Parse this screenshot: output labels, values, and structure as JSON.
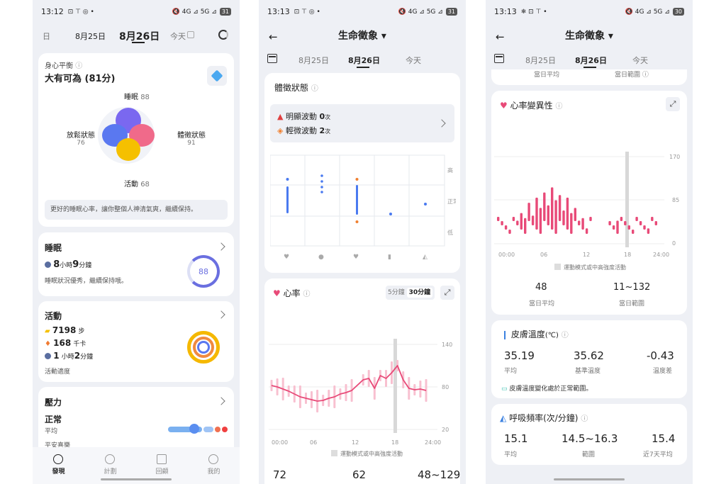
{
  "p1": {
    "status": {
      "time": "13:12",
      "icons": "⊡ ⊤ ◎ •",
      "right": "🔇 4G ⊿ 5G ⊿",
      "battery": "31"
    },
    "dates": {
      "prev_cut": "日",
      "d1": "8月25日",
      "d2": "8月26日",
      "d3": "今天"
    },
    "balance": {
      "label": "身心平衡",
      "value": "大有可為 (81分)",
      "sleep_label": "睡眠",
      "sleep_val": "88",
      "relax_label": "放鬆狀態",
      "relax_val": "76",
      "body_label": "體徵狀態",
      "body_val": "91",
      "activity_label": "活動",
      "activity_val": "68",
      "tip": "更好的睡眠心率，讓你整個人神清氣爽，繼續保持。"
    },
    "sleep": {
      "title": "睡眠",
      "h": "8",
      "h_unit": "小時",
      "m": "9",
      "m_unit": "分鐘",
      "desc": "睡眠狀況優秀，繼續保持哦。",
      "score": "88"
    },
    "activity": {
      "title": "活動",
      "steps": "7198",
      "steps_unit": "步",
      "kcal": "168",
      "kcal_unit": "千卡",
      "h": "1",
      "h_unit": "小時",
      "m": "2",
      "m_unit": "分鐘",
      "desc": "活動適度"
    },
    "stress": {
      "title": "壓力",
      "state": "正常",
      "sub": "平均",
      "note": "平安喜樂"
    },
    "nav": {
      "n1": "發現",
      "n2": "計劃",
      "n3": "回顧",
      "n4": "我的"
    }
  },
  "p2": {
    "status": {
      "time": "13:13",
      "icons": "⊡ ⊤ ◎ •",
      "right": "🔇 4G ⊿ 5G ⊿",
      "battery": "31"
    },
    "header": {
      "title": "生命徵象 ▾",
      "back": "←"
    },
    "dates": {
      "d1": "8月25日",
      "d2": "8月26日",
      "d3": "今天"
    },
    "body": {
      "title": "體徵狀態",
      "alert1_label": "明顯波動",
      "alert1_val": "0",
      "alert1_unit": "次",
      "alert2_label": "輕微波動",
      "alert2_val": "2",
      "alert2_unit": "次",
      "y_high": "高",
      "y_normal": "正常",
      "y_low": "低"
    },
    "hr": {
      "title": "心率",
      "opt1": "5分鐘",
      "opt2": "30分鐘",
      "y1": "140",
      "y2": "80",
      "y3": "20",
      "x1": "00:00",
      "x2": "06",
      "x3": "12",
      "x4": "18",
      "x5": "24:00",
      "legend": "運動模式或中高強度活動",
      "v1": "72",
      "v2": "62",
      "v3": "48~129"
    }
  },
  "p3": {
    "status": {
      "time": "13:13",
      "icons": "❄ ⊡ ⊤ •",
      "right": "🔇 4G ⊿ 5G ⊿",
      "battery": "30"
    },
    "header": {
      "title": "生命徵象 ▾",
      "back": "←"
    },
    "dates": {
      "d1": "8月25日",
      "d2": "8月26日",
      "d3": "今天"
    },
    "top": {
      "l1": "當日平均",
      "l2": "當日範圍 ⓘ"
    },
    "hrv": {
      "title": "心率變異性",
      "y1": "170",
      "y2": "85",
      "y3": "0",
      "x1": "00:00",
      "x2": "06",
      "x3": "12",
      "x4": "18",
      "x5": "24:00",
      "legend": "運動模式或中高強度活動",
      "v1": "48",
      "l1": "當日平均",
      "v2": "11~132",
      "l2": "當日範圍"
    },
    "skin": {
      "title": "皮膚溫度",
      "unit": "(℃)",
      "v1": "35.19",
      "l1": "平均",
      "v2": "35.62",
      "l2": "基準溫度",
      "v3": "-0.43",
      "l3": "溫度差",
      "note": "皮膚溫度變化處於正常範圍。"
    },
    "resp": {
      "title": "呼吸頻率",
      "unit": "(次/分鐘)",
      "v1": "15.1",
      "l1": "平均",
      "v2": "14.5~16.3",
      "l2": "範圍",
      "v3": "15.4",
      "l3": "近7天平均"
    }
  },
  "chart_data": [
    {
      "type": "line",
      "title": "心率",
      "x": [
        "00:00",
        "06",
        "12",
        "18",
        "24:00"
      ],
      "ylim": [
        20,
        140
      ],
      "yticks": [
        140,
        80,
        20
      ],
      "series": [
        {
          "values": [
            82,
            80,
            77,
            74,
            70,
            66,
            64,
            62,
            60,
            61,
            64,
            66,
            70,
            72,
            75,
            90,
            92,
            78,
            96,
            92,
            100,
            110,
            90,
            78,
            76,
            77,
            75
          ]
        }
      ]
    },
    {
      "type": "bar",
      "title": "心率變異性",
      "x": [
        "00:00",
        "06",
        "12",
        "18",
        "24:00"
      ],
      "ylim": [
        0,
        170
      ],
      "yticks": [
        170,
        85,
        0
      ],
      "series": [
        {
          "values": [
            30,
            25,
            35,
            20,
            40,
            45,
            60,
            50,
            80,
            55,
            90,
            70,
            100,
            75,
            110,
            85,
            95,
            65,
            90,
            60,
            70,
            45,
            50,
            30,
            25,
            0,
            0,
            0,
            0,
            35,
            20,
            45,
            15,
            10,
            15,
            25,
            40,
            20,
            35,
            30,
            45,
            40
          ]
        }
      ]
    }
  ]
}
